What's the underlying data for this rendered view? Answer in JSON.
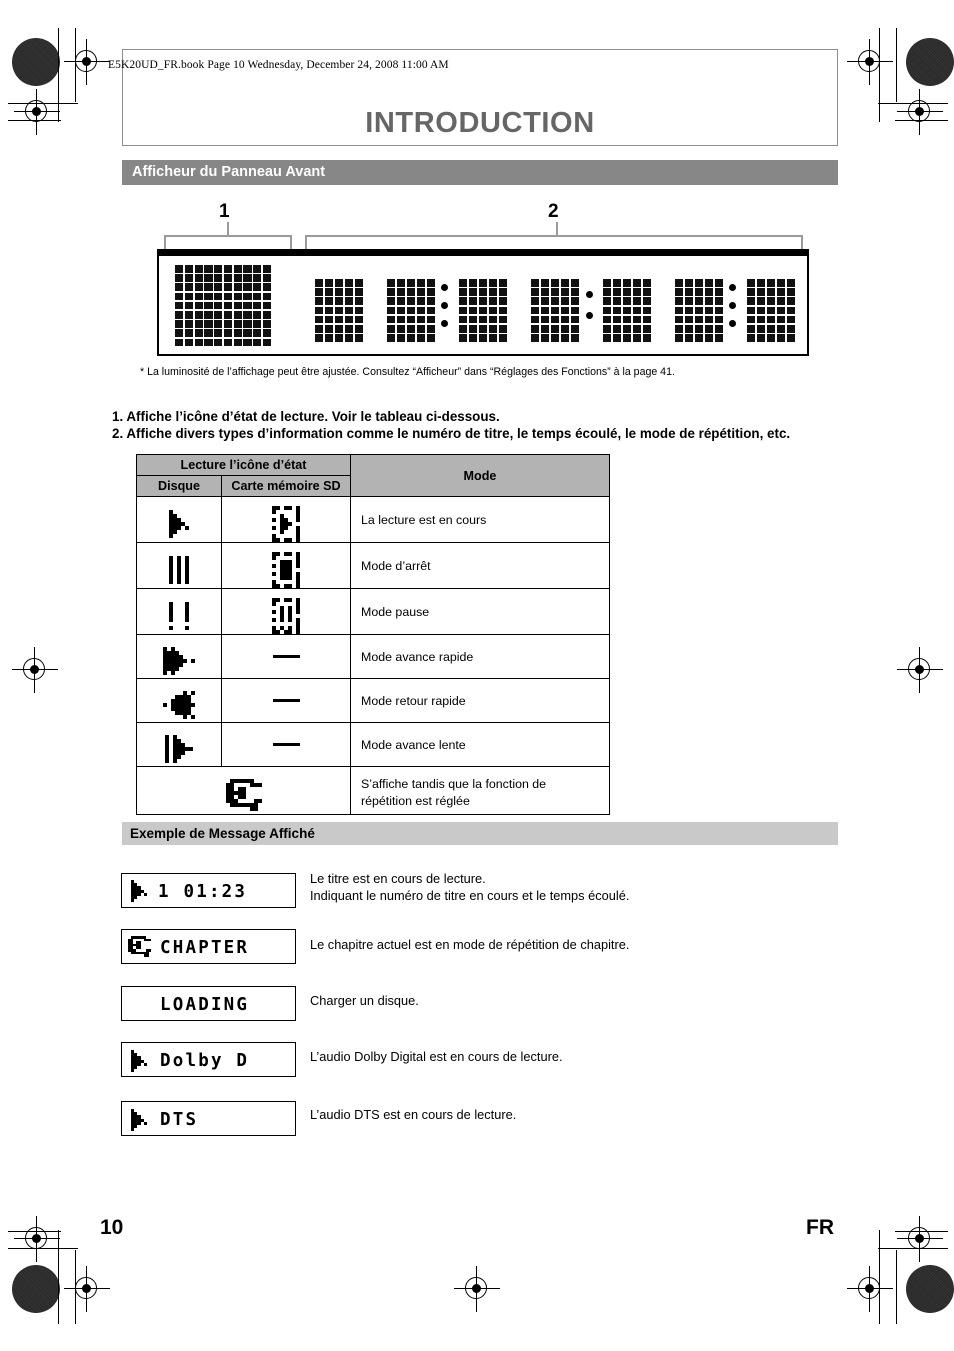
{
  "header": {
    "book_line": "E5K20UD_FR.book  Page 10  Wednesday, December 24, 2008  11:00 AM",
    "chapter_title": "INTRODUCTION",
    "section_title": "Afficheur du Panneau Avant"
  },
  "diagram": {
    "callout_1": "1",
    "callout_2": "2",
    "footnote": "* La luminosité de l’affichage peut être ajustée. Consultez “Afficheur” dans “Réglages des Fonctions” à la page 41."
  },
  "list": [
    "1. Affiche l’icône d’état de lecture. Voir le tableau ci-dessous.",
    "2. Affiche divers types d’information comme le numéro de titre, le temps écoulé, le mode de répétition, etc."
  ],
  "table": {
    "group_header": "Lecture l’icône d’état",
    "col_disc": "Disque",
    "col_sd": "Carte mémoire SD",
    "col_mode": "Mode",
    "rows": [
      {
        "icon_disc": "play-icon",
        "icon_sd": "sd-play-icon",
        "mode": "La lecture est en cours"
      },
      {
        "icon_disc": "stop-icon",
        "icon_sd": "sd-stop-icon",
        "mode": "Mode d’arrêt"
      },
      {
        "icon_disc": "pause-icon",
        "icon_sd": "sd-pause-icon",
        "mode": "Mode pause"
      },
      {
        "icon_disc": "fast-forward-icon",
        "icon_sd": "dash",
        "mode": "Mode avance rapide"
      },
      {
        "icon_disc": "fast-reverse-icon",
        "icon_sd": "dash",
        "mode": "Mode retour rapide"
      },
      {
        "icon_disc": "slow-forward-icon",
        "icon_sd": "dash",
        "mode": "Mode avance lente"
      },
      {
        "icon_disc": "repeat-icon",
        "icon_sd": "",
        "mode": "S’affiche tandis que la fonction de\nrépétition est réglée"
      }
    ]
  },
  "examples": {
    "header": "Exemple de Message Affiché",
    "items": [
      {
        "lcd": "1        01:23",
        "icon": "play-icon",
        "desc_line1": "Le titre est en cours de lecture.",
        "desc_line2": "Indiquant le numéro de titre en cours et le temps écoulé."
      },
      {
        "lcd": "CHAPTER",
        "icon": "repeat-icon",
        "desc_line1": "Le chapitre actuel est en mode de répétition de chapitre.",
        "desc_line2": ""
      },
      {
        "lcd": "LOADING",
        "icon": "",
        "desc_line1": "Charger un disque.",
        "desc_line2": ""
      },
      {
        "lcd": "Dolby D",
        "icon": "play-icon",
        "desc_line1": "L’audio Dolby Digital est en cours de lecture.",
        "desc_line2": ""
      },
      {
        "lcd": "DTS",
        "icon": "play-icon",
        "desc_line1": "L’audio DTS est en cours de lecture.",
        "desc_line2": ""
      }
    ]
  },
  "footer": {
    "page_number": "10",
    "language": "FR"
  },
  "colors": {
    "band_dark": "#878787",
    "band_light": "#c9c9c9",
    "title_gray": "#666666",
    "table_header": "#b3b3b3"
  }
}
